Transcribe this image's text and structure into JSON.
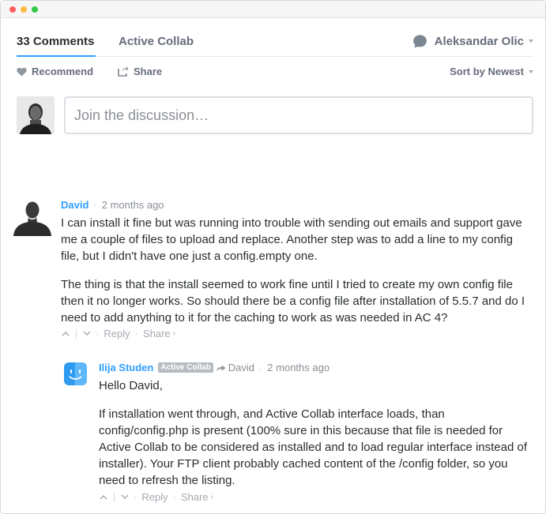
{
  "nav": {
    "comments_tab": "33 Comments",
    "community_tab": "Active Collab",
    "user_name": "Aleksandar Olic",
    "bubble_icon": "speech-bubble-icon",
    "accent_color": "#2e9fff"
  },
  "toolbar": {
    "recommend": "Recommend",
    "recommend_icon": "heart-icon",
    "share": "Share",
    "share_icon": "share-arrow-icon",
    "sort": "Sort by Newest"
  },
  "composer": {
    "placeholder": "Join the discussion…"
  },
  "comments": [
    {
      "author": "David",
      "time": "2 months ago",
      "avatar_icon": "default-avatar-silhouette",
      "paragraphs": [
        "I can install it fine but was running into trouble with sending out emails and support gave me a couple of files to upload and replace. Another step was to add a line to my config file, but I didn't have one just a config.empty one.",
        "The thing is that the install seemed to work fine until I tried to create my own config file then it no longer works. So should there be a config file after installation of 5.5.7 and do I need to add anything to it for the caching to work as was needed in AC 4?"
      ],
      "reply_label": "Reply",
      "share_label": "Share"
    },
    {
      "author": "Ilija Studen",
      "badge": "Active Collab",
      "in_reply_to": "David",
      "time": "2 months ago",
      "avatar_icon": "finder-face-icon",
      "paragraphs": [
        "Hello David,",
        "If installation went through, and Active Collab interface loads, than config/config.php is present (100% sure in this because that file is needed for Active Collab to be considered as installed and to load regular interface instead of installer). Your FTP client probably cached content of the /config folder, so you need to refresh the listing."
      ],
      "reply_label": "Reply",
      "share_label": "Share"
    }
  ]
}
